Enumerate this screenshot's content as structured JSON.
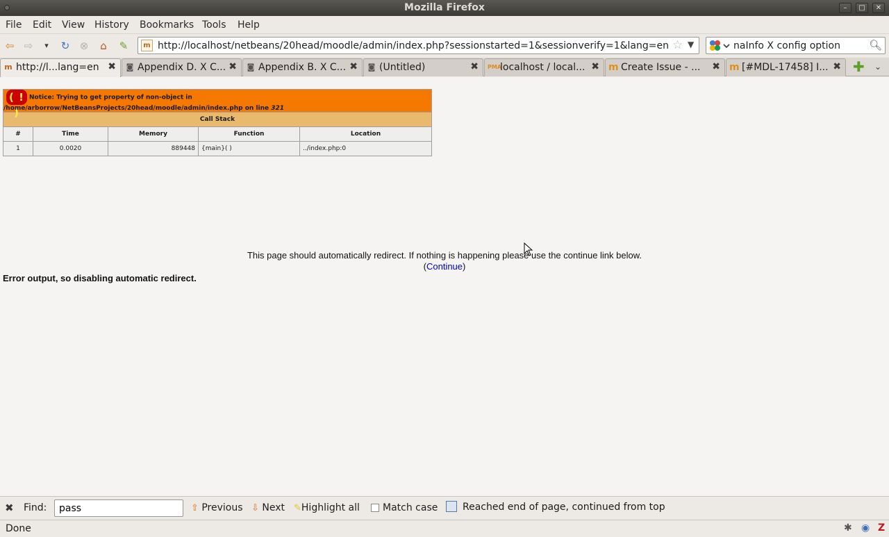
{
  "window": {
    "title": "Mozilla Firefox"
  },
  "menu": {
    "file": "File",
    "edit": "Edit",
    "view": "View",
    "history": "History",
    "bookmarks": "Bookmarks",
    "tools": "Tools",
    "help": "Help"
  },
  "navbar": {
    "url": "http://localhost/netbeans/20head/moodle/admin/index.php?sessionstarted=1&sessionverify=1&lang=en",
    "search_value": "naInfo X config option"
  },
  "tabs": [
    {
      "label": "http://l...lang=en",
      "icon": "moodle-icon",
      "active": true
    },
    {
      "label": "Appendix D. X C...",
      "icon": "page-icon",
      "active": false
    },
    {
      "label": "Appendix B. X C...",
      "icon": "page-icon",
      "active": false
    },
    {
      "label": "(Untitled)",
      "icon": "page-icon",
      "active": false
    },
    {
      "label": "localhost / local...",
      "icon": "phpmyadmin-icon",
      "active": false
    },
    {
      "label": "Create Issue - ...",
      "icon": "moodle-m-icon",
      "active": false
    },
    {
      "label": "[#MDL-17458] I...",
      "icon": "moodle-m-icon",
      "active": false
    }
  ],
  "xdebug": {
    "icon_text": "( ! )",
    "notice_prefix": "Notice: Trying to get property of non-object in /home/arborrow/NetBeansProjects/20head/moodle/admin/index.php on line ",
    "line": "321",
    "call_stack_label": "Call Stack",
    "columns": [
      "#",
      "Time",
      "Memory",
      "Function",
      "Location"
    ],
    "rows": [
      {
        "num": "1",
        "time": "0.0020",
        "memory": "889448",
        "function": "{main}( )",
        "location": "../index.php:0"
      }
    ],
    "colors": {
      "header": "#f57900",
      "callstack": "#e9b96e",
      "cells": "#eeeeec",
      "icon_bg": "#cc0000",
      "icon_fg": "#fce94f"
    }
  },
  "page": {
    "redirect_text": "This page should automatically redirect. If nothing is happening please use the continue link below.",
    "continue_open": "(",
    "continue_label": "Continue",
    "continue_close": ")",
    "error_output": "Error output, so disabling automatic redirect."
  },
  "findbar": {
    "find_label": "Find:",
    "find_value": "pass",
    "previous": "Previous",
    "next": "Next",
    "highlight_all": "Highlight all",
    "match_case": "Match case",
    "status": "Reached end of page, continued from top"
  },
  "statusbar": {
    "text": "Done"
  }
}
